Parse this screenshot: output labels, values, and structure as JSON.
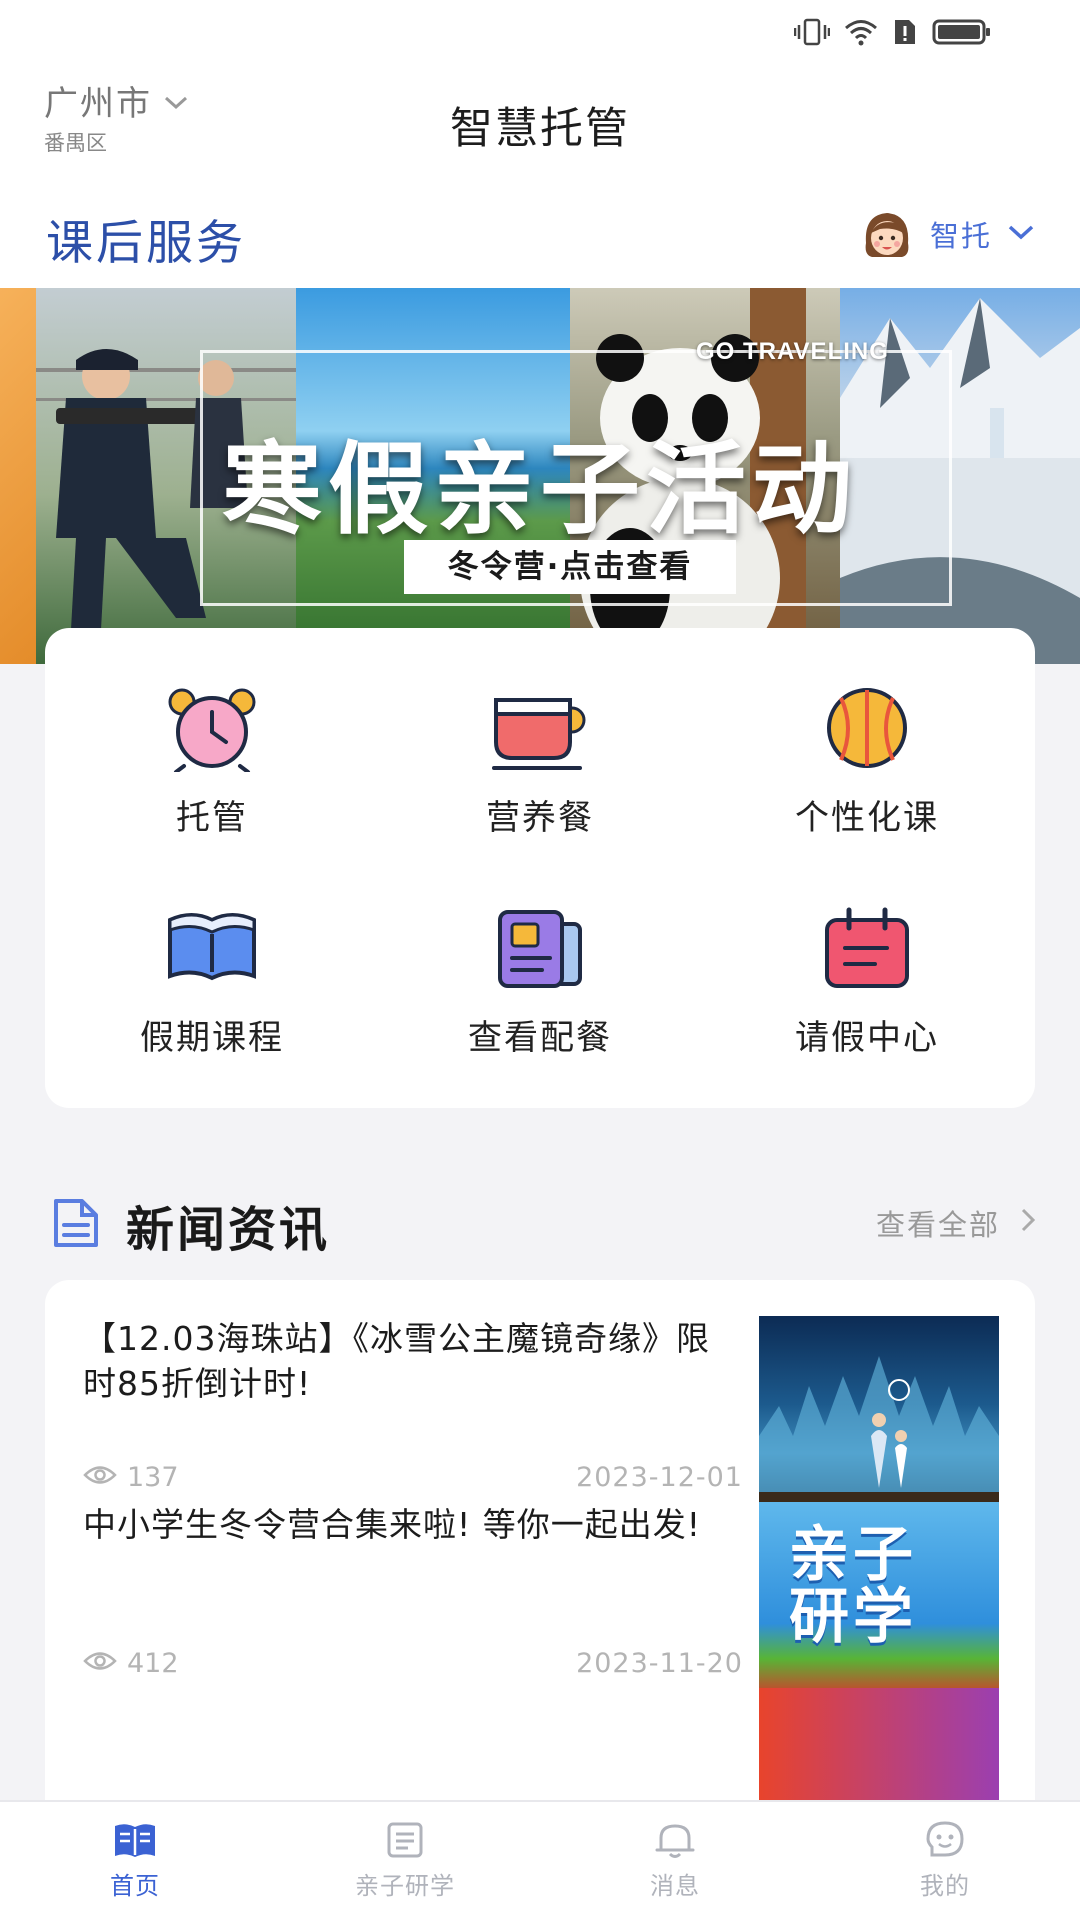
{
  "header": {
    "city": "广州市",
    "district": "番禺区",
    "app_title": "智慧托管"
  },
  "section": {
    "title": "课后服务",
    "profile_name": "智托"
  },
  "banner": {
    "tag": "GO TRAVELING",
    "title": "寒假亲子活动",
    "cta": "冬令营·点击查看"
  },
  "services": [
    {
      "label": "托管",
      "icon": "alarm-clock-icon"
    },
    {
      "label": "营养餐",
      "icon": "soup-bowl-icon"
    },
    {
      "label": "个性化课",
      "icon": "basketball-icon"
    },
    {
      "label": "假期课程",
      "icon": "open-book-icon"
    },
    {
      "label": "查看配餐",
      "icon": "menu-document-icon"
    },
    {
      "label": "请假中心",
      "icon": "calendar-icon"
    }
  ],
  "news": {
    "title": "新闻资讯",
    "view_all": "查看全部",
    "items": [
      {
        "headline": "【12.03海珠站】《冰雪公主魔镜奇缘》限时85折倒计时!",
        "views": "137",
        "date": "2023-12-01"
      },
      {
        "headline": "中小学生冬令营合集来啦! 等你一起出发!",
        "views": "412",
        "date": "2023-11-20",
        "thumb_text": "亲子研学"
      },
      {
        "headline": "",
        "views": "",
        "date": ""
      }
    ]
  },
  "bottom_nav": [
    {
      "label": "首页",
      "active": true
    },
    {
      "label": "亲子研学",
      "active": false
    },
    {
      "label": "消息",
      "active": false
    },
    {
      "label": "我的",
      "active": false
    }
  ],
  "colors": {
    "accent": "#3b62d3",
    "section_title": "#2c4fa8",
    "background": "#f3f3f6"
  }
}
